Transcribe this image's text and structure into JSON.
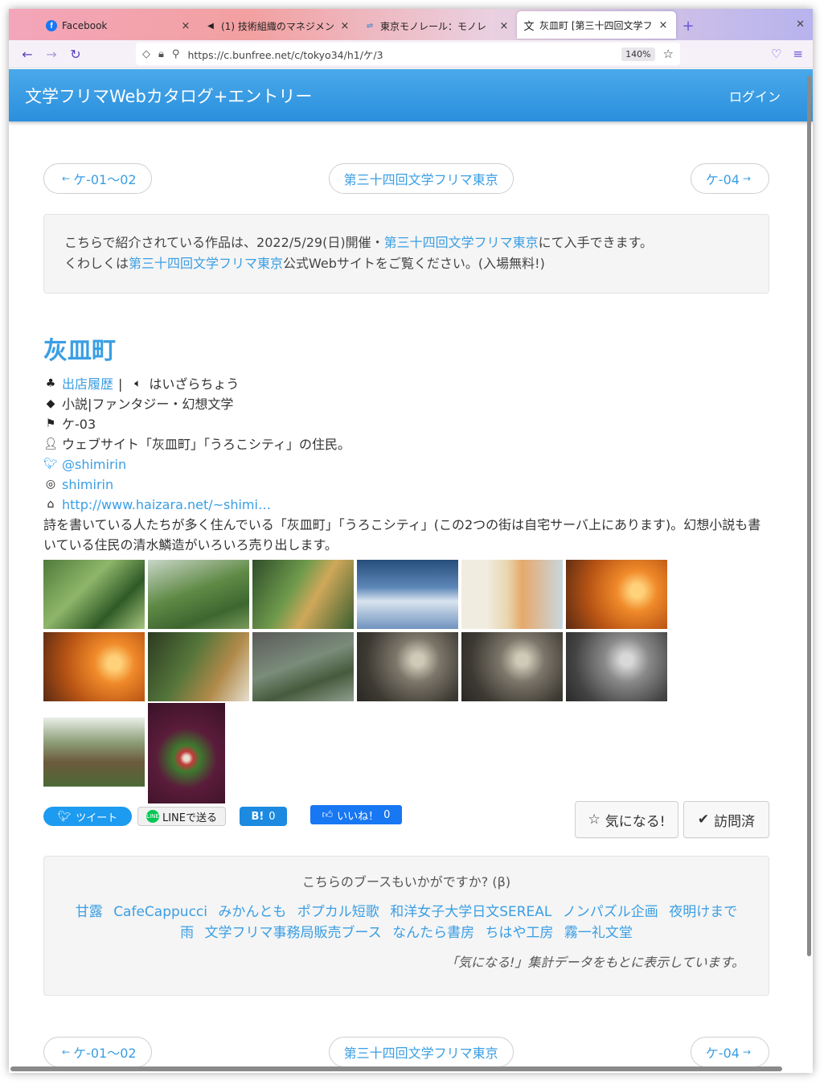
{
  "browser": {
    "tabs": [
      {
        "title": "Facebook",
        "icon": "facebook-icon",
        "active": false
      },
      {
        "title": "(1) 技術組織のマネジメン",
        "icon": "speaker-icon",
        "active": false
      },
      {
        "title": "東京モノレール：モノレ",
        "icon": "monorail-icon",
        "active": false
      },
      {
        "title": "灰皿町 [第三十四回文学フ",
        "icon": "translate-icon",
        "active": true
      }
    ],
    "url": "https://c.bunfree.net/c/tokyo34/h1/ケ/3",
    "zoom": "140%"
  },
  "appbar": {
    "brand": "文学フリマWebカタログ+エントリー",
    "login": "ログイン"
  },
  "pager": {
    "prev": "ケ-01〜02",
    "center": "第三十四回文学フリマ東京",
    "next": "ケ-04"
  },
  "notice": {
    "line1_pre": "こちらで紹介されている作品は、2022/5/29(日)開催・",
    "line1_link": "第三十四回文学フリマ東京",
    "line1_post": "にて入手できます。",
    "line2_pre": "くわしくは",
    "line2_link": "第三十四回文学フリマ東京",
    "line2_post": "公式Webサイトをご覧ください。(入場無料!)"
  },
  "circle": {
    "name": "灰皿町",
    "history_label": "出店履歴",
    "separator": "|",
    "reading": "はいざらちょう",
    "genre": "小説|ファンタジー・幻想文学",
    "booth": "ケ-03",
    "profile": "ウェブサイト「灰皿町」「うろこシティ」の住民。",
    "twitter": "@shimirin",
    "instagram": "shimirin",
    "website": "http://www.haizara.net/~shimi…",
    "description": "詩を書いている人たちが多く住んでいる「灰皿町」「うろこシティ」(この2つの街は自宅サーバ上にあります)。幻想小説も書いている住民の清水鱗造がいろいろ売り出します。"
  },
  "share": {
    "tweet": "ツイート",
    "line": "LINEで送る",
    "hatena": "B!",
    "hatena_count": "0",
    "fb_like": "いいね！",
    "fb_count": "0",
    "favorite": "気になる!",
    "visited": "訪問済"
  },
  "suggest": {
    "heading": "こちらのブースもいかがですか? (β)",
    "booths": [
      "甘露",
      "CafeCappucci",
      "みかんとも",
      "ポプカル短歌",
      "和洋女子大学日文SEREAL",
      "ノンパズル企画",
      "夜明けまで",
      "雨",
      "文学フリマ事務局販売ブース",
      "なんたら書房",
      "ちはや工房",
      "霧一礼文堂"
    ],
    "note": "「気になる!」集計データをもとに表示しています。"
  },
  "colors": {
    "accent": "#3a9ee4",
    "appbar": "#2a8fdd"
  }
}
